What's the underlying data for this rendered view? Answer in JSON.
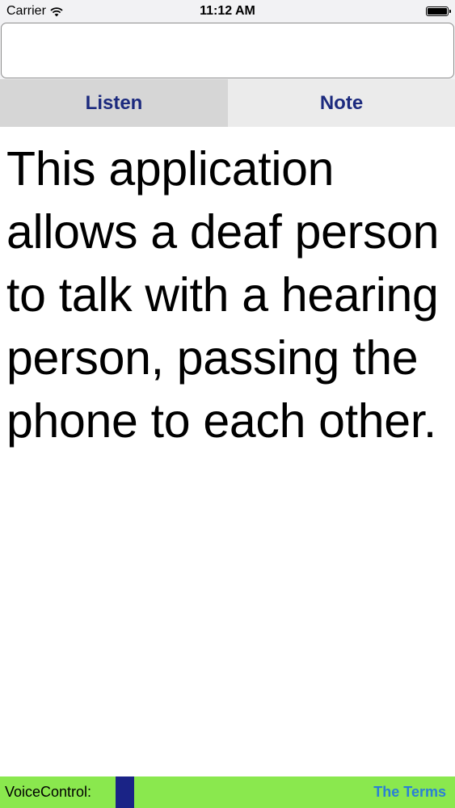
{
  "status_bar": {
    "carrier": "Carrier",
    "time": "11:12 AM",
    "wifi_icon": "wifi-icon",
    "battery_icon": "battery-full-icon",
    "battery_level": 1.0
  },
  "input": {
    "value": "",
    "placeholder": ""
  },
  "tabs": [
    {
      "label": "Listen",
      "selected": true
    },
    {
      "label": "Note",
      "selected": false
    }
  ],
  "main": {
    "text": "This application allows a deaf person to talk with a hearing person, passing the phone to each other."
  },
  "bottom_bar": {
    "voice_control_label": "VoiceControl:",
    "terms_label": "The Terms"
  },
  "colors": {
    "tab_text": "#1c2a7e",
    "bottom_bar_bg": "#8ae84e",
    "voice_indicator": "#1a2386",
    "terms_link": "#2a7fd6"
  }
}
